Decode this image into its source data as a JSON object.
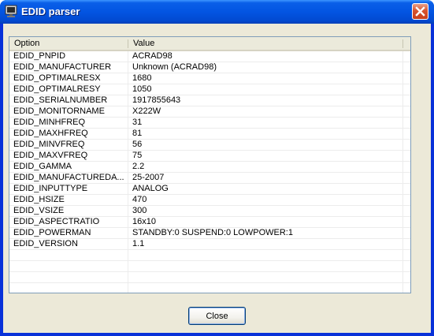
{
  "window": {
    "title": "EDID parser"
  },
  "list": {
    "columns": [
      "Option",
      "Value"
    ],
    "rows": [
      {
        "option": "EDID_PNPID",
        "value": "ACRAD98"
      },
      {
        "option": "EDID_MANUFACTURER",
        "value": "Unknown (ACRAD98)"
      },
      {
        "option": "EDID_OPTIMALRESX",
        "value": "1680"
      },
      {
        "option": "EDID_OPTIMALRESY",
        "value": "1050"
      },
      {
        "option": "EDID_SERIALNUMBER",
        "value": "1917855643"
      },
      {
        "option": "EDID_MONITORNAME",
        "value": "X222W"
      },
      {
        "option": "EDID_MINHFREQ",
        "value": "31"
      },
      {
        "option": "EDID_MAXHFREQ",
        "value": "81"
      },
      {
        "option": "EDID_MINVFREQ",
        "value": "56"
      },
      {
        "option": "EDID_MAXVFREQ",
        "value": "75"
      },
      {
        "option": "EDID_GAMMA",
        "value": "2.2"
      },
      {
        "option": "EDID_MANUFACTUREDA...",
        "value": "25-2007"
      },
      {
        "option": "EDID_INPUTTYPE",
        "value": "ANALOG"
      },
      {
        "option": "EDID_HSIZE",
        "value": "470"
      },
      {
        "option": "EDID_VSIZE",
        "value": "300"
      },
      {
        "option": "EDID_ASPECTRATIO",
        "value": "16x10"
      },
      {
        "option": "EDID_POWERMAN",
        "value": "STANDBY:0 SUSPEND:0 LOWPOWER:1"
      },
      {
        "option": "EDID_VERSION",
        "value": "1.1"
      }
    ],
    "empty_rows": 4
  },
  "buttons": {
    "close_label": "Close"
  },
  "icons": {
    "app": "monitor-app-icon",
    "close": "close-x-icon"
  },
  "colors": {
    "titlebar": "#0355e2",
    "close_button": "#d8542e",
    "dialog_bg": "#ece9d8"
  }
}
